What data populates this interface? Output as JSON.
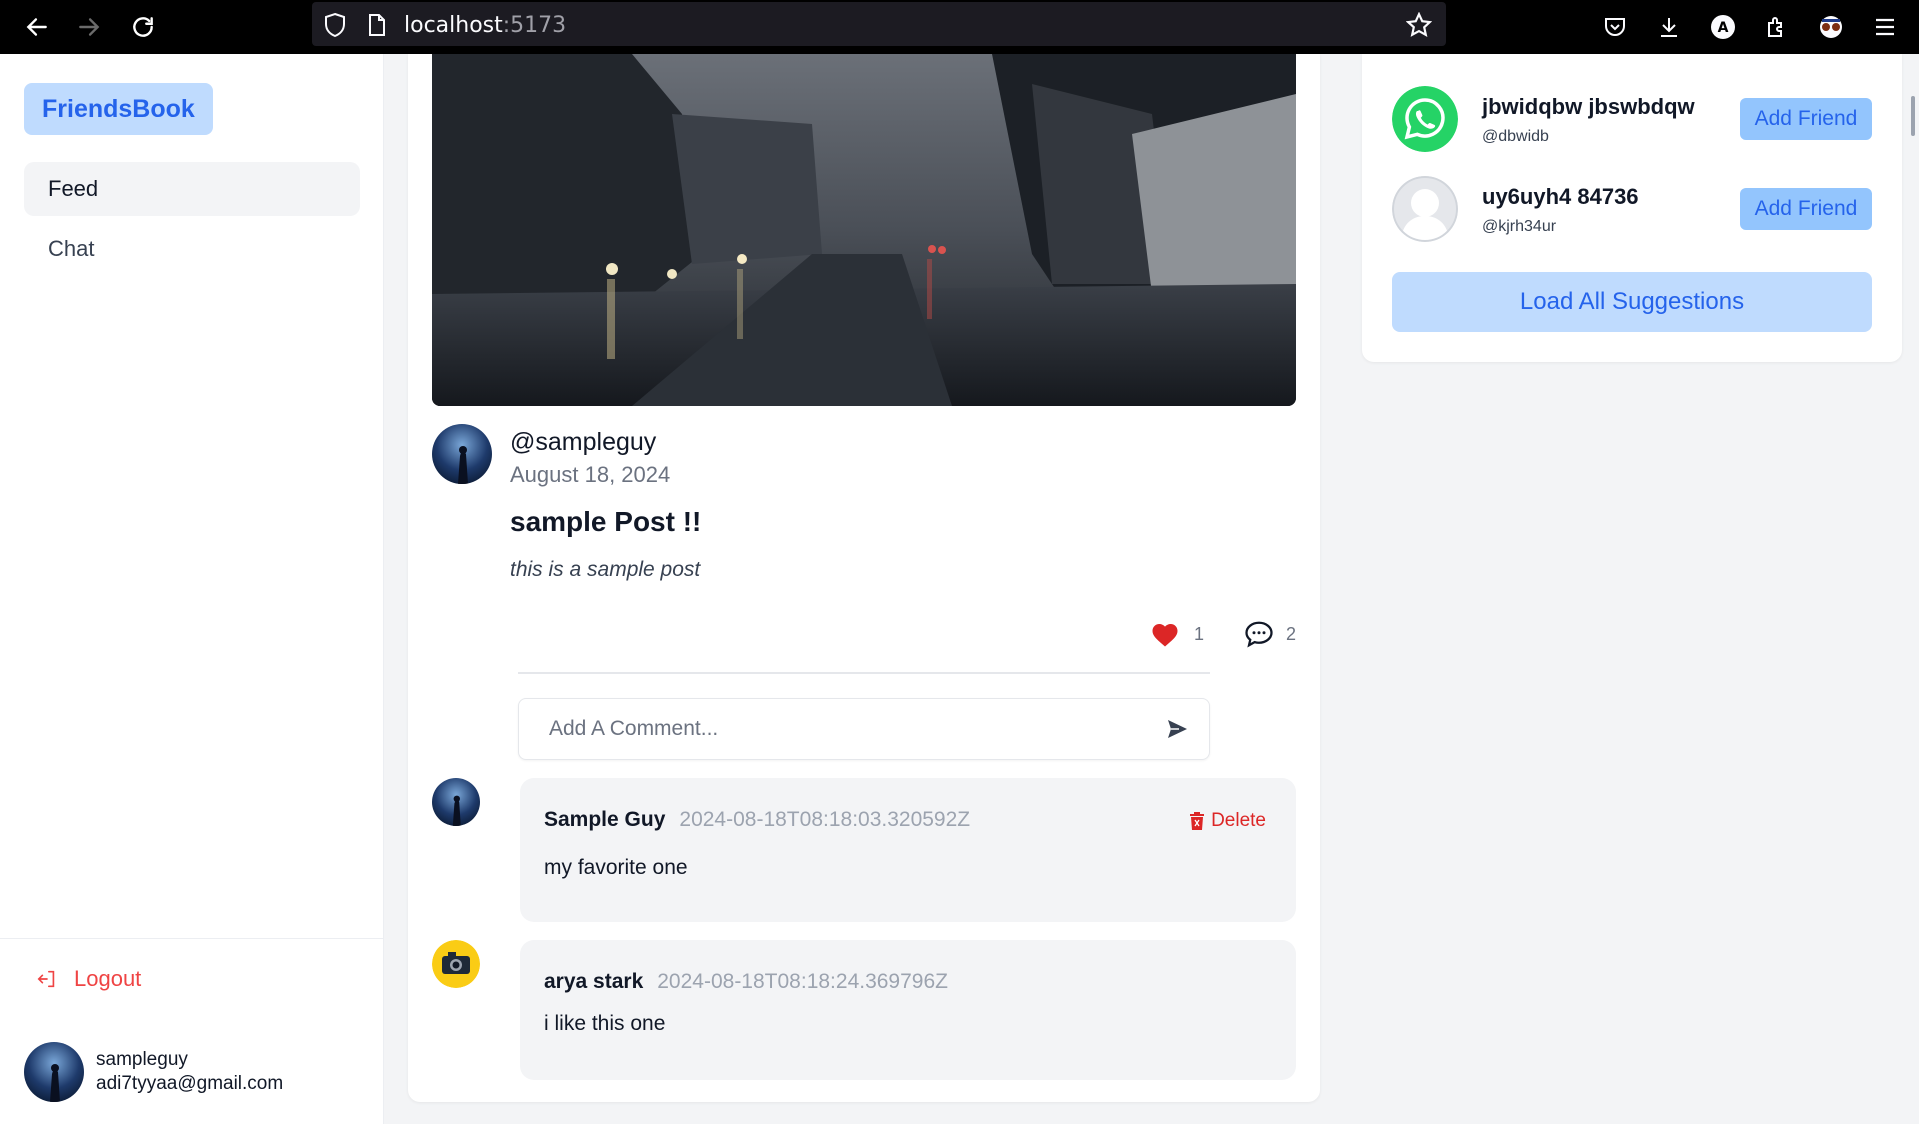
{
  "browser": {
    "url_host": "localhost",
    "url_port": ":5173"
  },
  "sidebar": {
    "brand": "FriendsBook",
    "items": [
      {
        "label": "Feed",
        "active": true
      },
      {
        "label": "Chat",
        "active": false
      }
    ],
    "logout_label": "Logout",
    "user": {
      "username": "sampleguy",
      "email": "adi7tyyaa@gmail.com"
    }
  },
  "post": {
    "username": "@sampleguy",
    "date": "August 18, 2024",
    "title": "sample Post !!",
    "body": "this is a sample post",
    "likes": "1",
    "comments": "2",
    "comment_placeholder": "Add A Comment..."
  },
  "comments": [
    {
      "name": "Sample Guy",
      "timestamp": "2024-08-18T08:18:03.320592Z",
      "text": "my favorite one",
      "delete_label": "Delete"
    },
    {
      "name": "arya stark",
      "timestamp": "2024-08-18T08:18:24.369796Z",
      "text": "i like this one"
    }
  ],
  "suggestions": {
    "items": [
      {
        "name": "jbwidqbw jbswbdqw",
        "handle": "@dbwidb",
        "button": "Add Friend"
      },
      {
        "name": "uy6uyh4 84736",
        "handle": "@kjrh34ur",
        "button": "Add Friend"
      }
    ],
    "load_all_label": "Load All Suggestions"
  },
  "colors": {
    "accent": "#2563eb",
    "accent_light": "#bfdbfe",
    "danger": "#ef4444",
    "like": "#dc2626"
  }
}
